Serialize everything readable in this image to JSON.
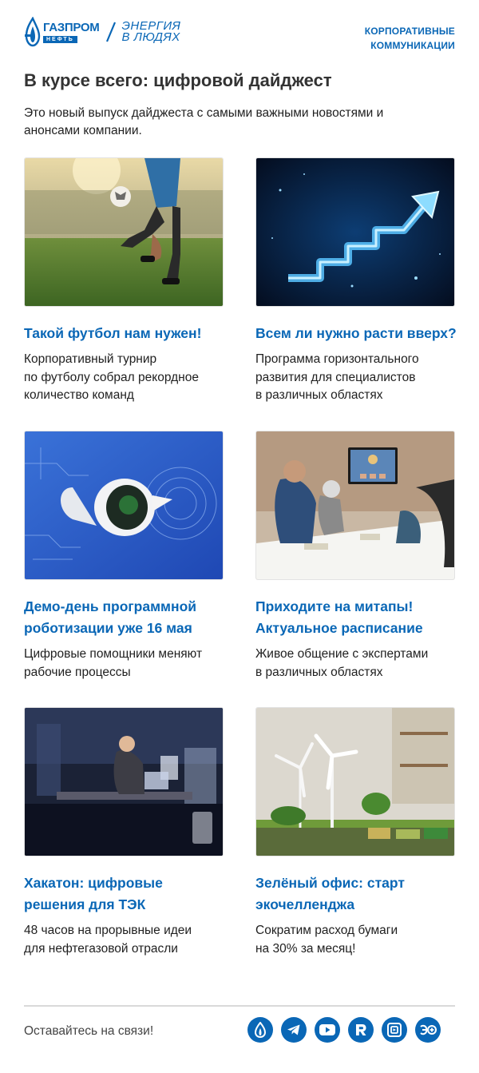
{
  "brand": {
    "logo_main": "ГАЗПРОМ",
    "logo_sub": "НЕФТЬ",
    "tagline_line1": "ЭНЕРГИЯ",
    "tagline_line2": "В ЛЮДЯХ",
    "accent": "#0a67b6"
  },
  "header": {
    "section_line1": "КОРПОРАТИВНЫЕ",
    "section_line2": "КОММУНИКАЦИИ"
  },
  "main": {
    "title": "В курсе всего: цифровой дайджест",
    "intro": "Это новый выпуск дайджеста с самыми важными новостями и анонсами компании."
  },
  "cards": [
    {
      "title": "Такой футбол нам нужен!",
      "text": "Корпоративный турнир\nпо футболу собрал рекордное\nколичество команд",
      "image": "football-photo"
    },
    {
      "title": "Всем ли нужно расти вверх?",
      "text": "Программа горизонтального\nразвития для специалистов\nв различных областях",
      "image": "growth-arrow-illustration"
    },
    {
      "title": "Демо-день программной\nроботизации уже 16 мая",
      "text": "Цифровые помощники меняют\nрабочие процессы",
      "image": "robot-illustration"
    },
    {
      "title": "Приходите на митапы!\nАктуальное расписание",
      "text": "Живое общение с экспертами\nв различных областях",
      "image": "meetup-photo"
    },
    {
      "title": "Хакатон: цифровые\nрешения для ТЭК",
      "text": "48 часов на прорывные идеи\nдля нефтегазовой отрасли",
      "image": "hackathon-photo"
    },
    {
      "title": "Зелёный офис: старт\nэкочелленджа",
      "text": "Сократим расход бумаги\nна 30% за месяц!",
      "image": "green-office-photo"
    }
  ],
  "footer": {
    "stay_connected": "Оставайтесь на связи!",
    "socials": [
      "gazprom-neft-icon",
      "telegram-icon",
      "youtube-icon",
      "rutube-icon",
      "vk-video-icon",
      "energy-app-icon"
    ]
  }
}
